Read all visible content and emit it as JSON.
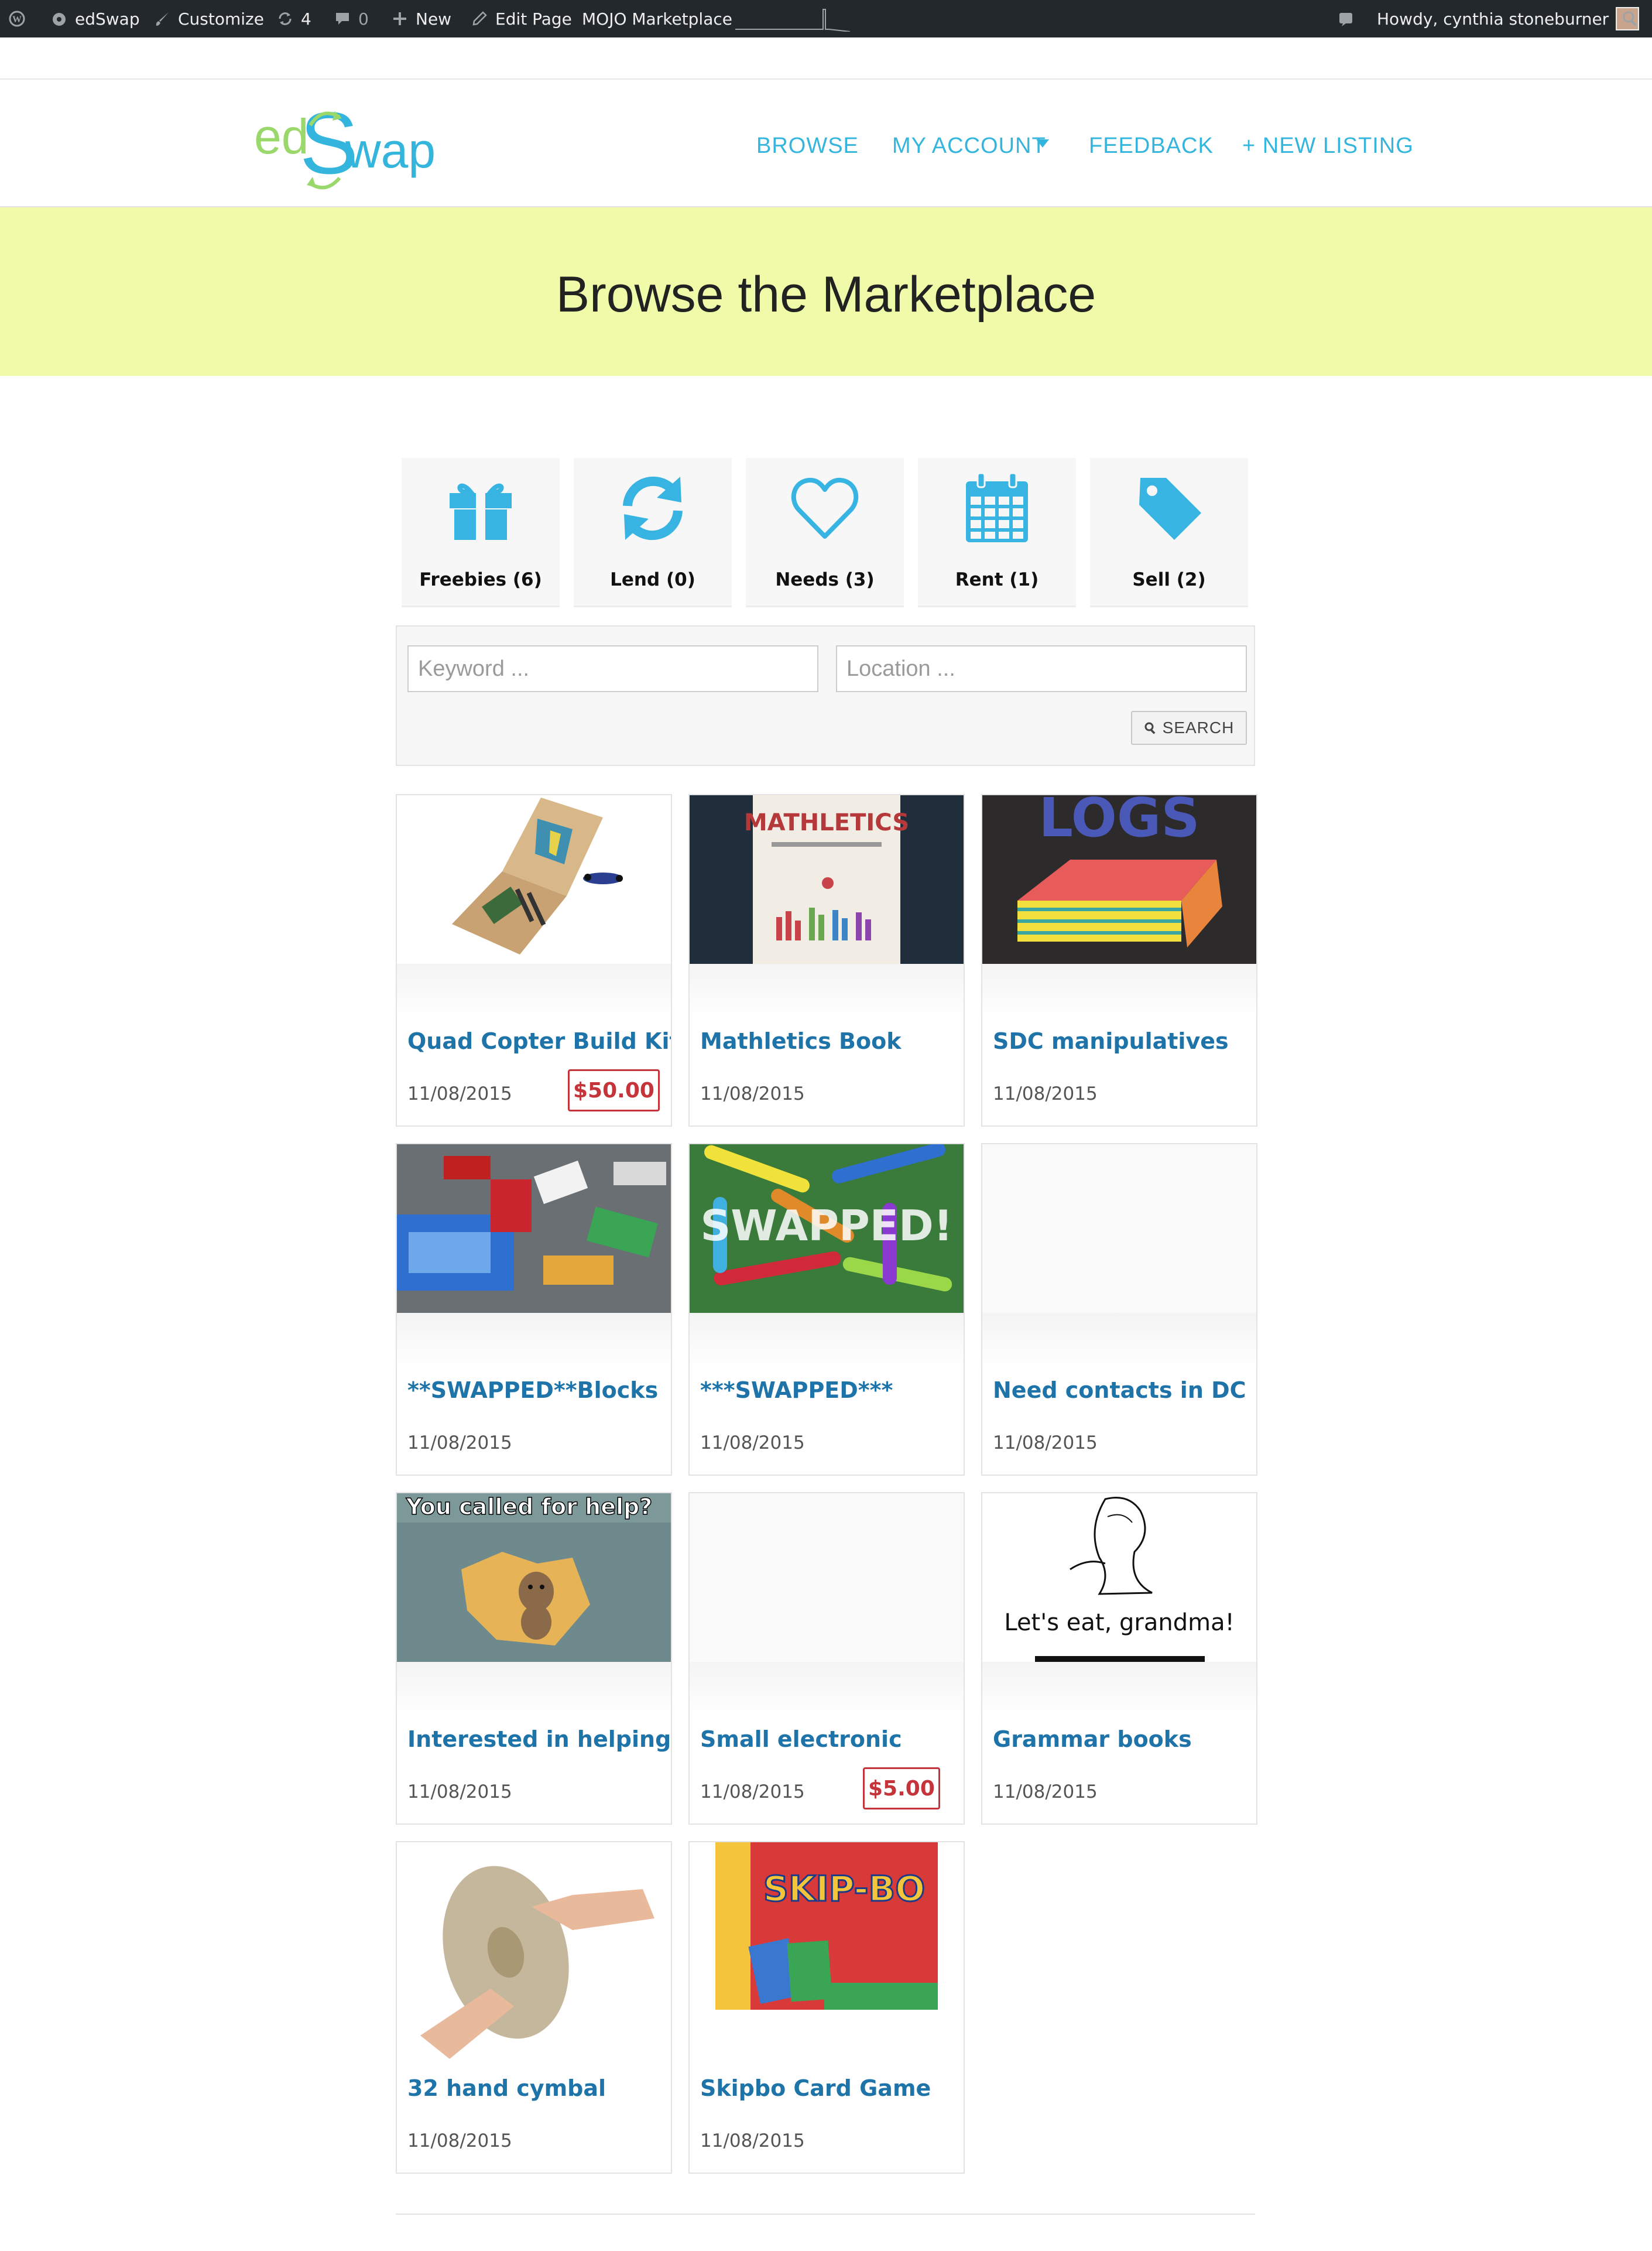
{
  "admin_bar": {
    "site_name": "edSwap",
    "customize": "Customize",
    "updates_count": "4",
    "comments_count": "0",
    "new_label": "New",
    "edit_page": "Edit Page",
    "marketplace": "MOJO Marketplace",
    "greeting": "Howdy, cynthia stoneburner"
  },
  "header": {
    "logo": {
      "part1": "ed",
      "part2": "S",
      "part3": "wap"
    },
    "nav": [
      "BROWSE",
      "MY ACCOUNT",
      "FEEDBACK",
      "+ NEW LISTING"
    ]
  },
  "hero": {
    "title": "Browse the Marketplace"
  },
  "categories": [
    {
      "label": "Freebies (6)",
      "icon": "gift-icon"
    },
    {
      "label": "Lend (0)",
      "icon": "refresh-icon"
    },
    {
      "label": "Needs (3)",
      "icon": "heart-icon"
    },
    {
      "label": "Rent (1)",
      "icon": "calendar-icon"
    },
    {
      "label": "Sell (2)",
      "icon": "tag-icon"
    }
  ],
  "search": {
    "keyword_placeholder": "Keyword ...",
    "location_placeholder": "Location ...",
    "button_label": "SEARCH"
  },
  "listings": [
    {
      "title": "Quad Copter Build Kit",
      "date": "11/08/2015",
      "price": "$50.00"
    },
    {
      "title": "Mathletics Book",
      "date": "11/08/2015",
      "price": "",
      "image_text": "MATHLETICS"
    },
    {
      "title": "SDC manipulatives",
      "date": "11/08/2015",
      "price": "",
      "image_text": "LOGS"
    },
    {
      "title": "**SWAPPED**Blocks",
      "date": "11/08/2015",
      "price": ""
    },
    {
      "title": "***SWAPPED***",
      "date": "11/08/2015",
      "price": "",
      "image_text": "SWAPPED!"
    },
    {
      "title": "Need contacts in DC",
      "date": "11/08/2015",
      "price": ""
    },
    {
      "title": "Interested in helping",
      "date": "11/08/2015",
      "price": "",
      "image_text": "You called for help?"
    },
    {
      "title": "Small electronic",
      "date": "11/08/2015",
      "price": "$5.00"
    },
    {
      "title": "Grammar books",
      "date": "11/08/2015",
      "price": "",
      "image_text": "Let's eat, grandma!"
    },
    {
      "title": "32 hand cymbal",
      "date": "11/08/2015",
      "price": ""
    },
    {
      "title": "Skipbo Card Game",
      "date": "11/08/2015",
      "price": "",
      "image_text": "SKIP-BO"
    }
  ],
  "colors": {
    "accent": "#34b5dd",
    "hero_bg": "#f0fbaa",
    "title_link": "#1e73a8",
    "price": "#c4343a",
    "admin_bar": "#23282d"
  }
}
